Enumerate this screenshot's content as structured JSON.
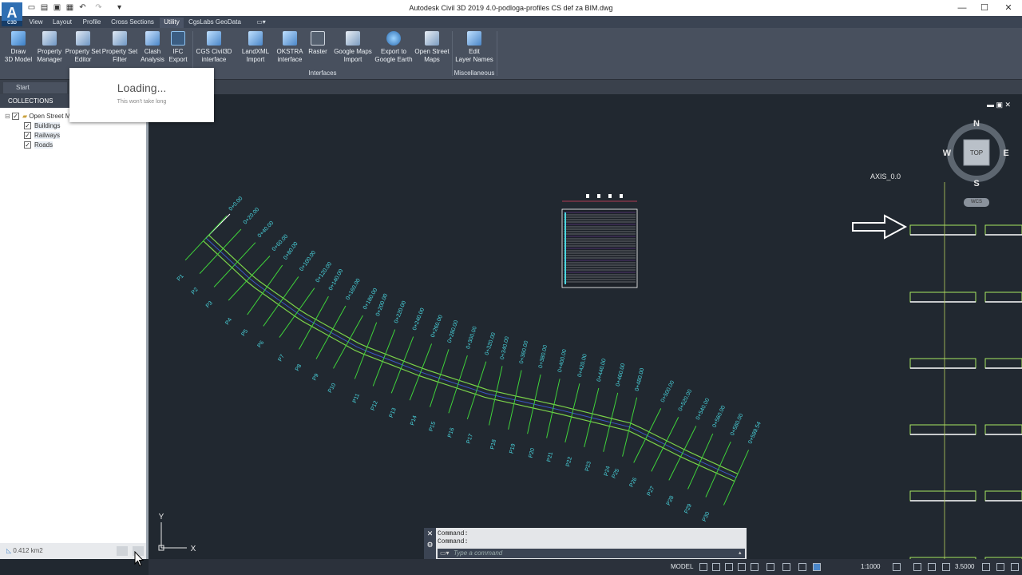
{
  "app": {
    "title": "Autodesk Civil 3D 2019    4.0-podloga-profiles CS def za BIM.dwg",
    "logo_letter": "A",
    "logo_sub": "C3D",
    "window_controls": [
      "—",
      "☐",
      "✕"
    ]
  },
  "tabs": [
    {
      "label": "View",
      "active": false
    },
    {
      "label": "Layout",
      "active": false
    },
    {
      "label": "Profile",
      "active": false
    },
    {
      "label": "Cross Sections",
      "active": false
    },
    {
      "label": "Utility",
      "active": true
    },
    {
      "label": "CgsLabs GeoData",
      "active": false
    }
  ],
  "ribbon": {
    "buttons": [
      {
        "label": "Draw\n3D Model",
        "icon": "cube-icon"
      },
      {
        "label": "Property\nManager",
        "icon": "property-icon"
      },
      {
        "label": "Property Set\nEditor",
        "icon": "property-icon"
      },
      {
        "label": "Property Set\nFilter",
        "icon": "filter-icon"
      },
      {
        "label": "Clash\nAnalysis",
        "icon": "clash-icon"
      },
      {
        "label": "IFC\nExport",
        "icon": "export-icon"
      },
      {
        "label": "CGS Civil3D\ninterface",
        "icon": "interface-icon"
      },
      {
        "label": "LandXML\nImport",
        "icon": "import-icon"
      },
      {
        "label": "OKSTRA\ninterface",
        "icon": "interface-icon"
      },
      {
        "label": "Raster",
        "icon": "raster-icon"
      },
      {
        "label": "Google Maps\nImport",
        "icon": "map-icon"
      },
      {
        "label": "Export to\nGoogle Earth",
        "icon": "globe-icon"
      },
      {
        "label": "Open Street\nMaps",
        "icon": "map-icon"
      },
      {
        "label": "Edit\nLayer Names",
        "icon": "layers-icon"
      }
    ],
    "panels": [
      "Interfaces",
      "Miscellaneous"
    ]
  },
  "start_tab": "Start",
  "collections": {
    "header": "COLLECTIONS",
    "root": "Open Street M",
    "items": [
      "Buildings",
      "Railways",
      "Roads"
    ],
    "area": "0.412 km2"
  },
  "loading": {
    "title": "Loading...",
    "subtitle": "This won't take long"
  },
  "drawing": {
    "axis_label": "AXIS_0.0",
    "stations": [
      "0+0.00",
      "0+20.00",
      "0+40.00",
      "0+60.00",
      "0+80.00",
      "0+100.00",
      "0+120.00",
      "0+140.00",
      "0+160.00",
      "0+180.00",
      "0+200.00",
      "0+220.00",
      "0+240.00",
      "0+260.00",
      "0+280.00",
      "0+300.00",
      "0+320.00",
      "0+340.00",
      "0+360.00",
      "0+380.00",
      "0+400.00",
      "0+420.00",
      "0+440.00",
      "0+460.00",
      "0+480.00",
      "0+500.00",
      "0+520.00",
      "0+540.00",
      "0+560.00",
      "0+580.00",
      "0+589.54"
    ],
    "profiles": [
      "P1",
      "P2",
      "P3",
      "P4",
      "P5",
      "P6",
      "P7",
      "P8",
      "P9",
      "P10",
      "P11",
      "P12",
      "P13",
      "P14",
      "P15",
      "P16",
      "P17",
      "P18",
      "P19",
      "P20",
      "P21",
      "P22",
      "P23",
      "P24",
      "P25",
      "P26",
      "P27",
      "P28",
      "P29",
      "P30"
    ]
  },
  "viewcube": {
    "n": "N",
    "s": "S",
    "e": "E",
    "w": "W",
    "face": "TOP",
    "wcs": "WCS"
  },
  "ucs": {
    "x": "X",
    "y": "Y"
  },
  "command": {
    "history": [
      "Command:",
      "Command:"
    ],
    "placeholder": "Type a command"
  },
  "status": {
    "model": "MODEL",
    "scale": "1:1000",
    "value": "3.5000"
  }
}
